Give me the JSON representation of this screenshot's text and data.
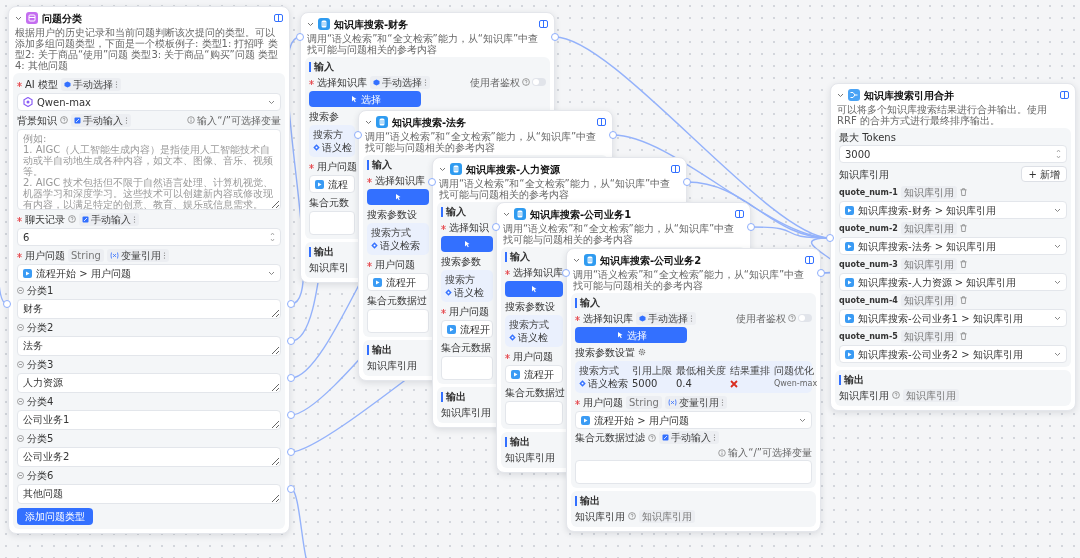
{
  "classify": {
    "title": "问题分类",
    "description": "根据用户的历史记录和当前问题判断该次提问的类型。可以添加多组问题类型，下面是一个模板例子: 类型1: 打招呼 类型2: 关于商品“使用”问题 类型3: 关于商品“购买”问题 类型4: 其他问题",
    "model": {
      "label": "AI 模型",
      "required": true,
      "mode": "手动选择",
      "value": "Qwen-max"
    },
    "background": {
      "label": "背景知识",
      "mode": "手动输入",
      "hint": "输入“/”可选择变量",
      "placeholder": "例如:\n1. AIGC（人工智能生成内容）是指使用人工智能技术自动或半自动地生成各种内容，如文本、图像、音乐、视频等。\n2. AIGC 技术包括但不限于自然语言处理、计算机视觉、机器学习和深度学习。这些技术可以创建新内容或修改现有内容，以满足特定的创意、教育、娱乐或信息需求。"
    },
    "history": {
      "label": "聊天记录",
      "required": true,
      "mode": "手动输入",
      "value": "6"
    },
    "question": {
      "label": "用户问题",
      "required": true,
      "type": "String",
      "mode": "变量引用",
      "value": "流程开始 > 用户问题"
    },
    "categories": [
      {
        "label": "分类1",
        "value": "财务"
      },
      {
        "label": "分类2",
        "value": "法务"
      },
      {
        "label": "分类3",
        "value": "人力资源"
      },
      {
        "label": "分类4",
        "value": "公司业务1"
      },
      {
        "label": "分类5",
        "value": "公司业务2"
      },
      {
        "label": "分类6",
        "value": "其他问题"
      }
    ],
    "add_button": "添加问题类型"
  },
  "kb_cards": [
    {
      "title": "知识库搜索-财务",
      "description": "调用“语义检索”和“全文检索”能力，从“知识库”中查找可能与问题相关的参考内容",
      "input": {
        "heading": "输入",
        "kb_required": true,
        "kb_label": "选择知识库",
        "kb_mode": "手动选择",
        "auth_label": "使用者鉴权",
        "auth_on": false,
        "select_button": "选择",
        "params_heading": "搜索参",
        "params": [
          {
            "label": "搜索方",
            "kind": "method",
            "value": "语义检"
          }
        ],
        "question_required": true,
        "question_label": "用户问题",
        "question_value": "流程",
        "filter_label": "集合元数"
      },
      "output": {
        "heading": "输出",
        "ref_label": "知识库引"
      }
    },
    {
      "title": "知识库搜索-法务",
      "description": "调用“语义检索”和“全文检索”能力，从“知识库”中查找可能与问题相关的参考内容",
      "input": {
        "heading": "输入",
        "kb_required": true,
        "kb_label": "选择知识库",
        "params_heading": "搜索参数设",
        "params": [
          {
            "label": "搜索方式",
            "kind": "method",
            "value": "语义检索"
          }
        ],
        "question_required": true,
        "question_label": "用户问题",
        "question_value": "流程开",
        "filter_label": "集合元数据过"
      },
      "output": {
        "heading": "输出",
        "ref_label": "知识库引用"
      }
    },
    {
      "title": "知识库搜索-人力资源",
      "description": "调用“语义检索”和“全文检索”能力，从“知识库”中查找可能与问题相关的参考内容",
      "input": {
        "heading": "输入",
        "kb_required": true,
        "kb_label": "选择知识",
        "params_heading": "搜索参数",
        "params": [
          {
            "label": "搜索方",
            "kind": "method",
            "value": "语义检"
          }
        ],
        "question_required": true,
        "question_label": "用户问题",
        "question_value": "流程开",
        "filter_label": "集合元数据"
      },
      "output": {
        "heading": "输出",
        "ref_label": "知识库引用"
      }
    },
    {
      "title": "知识库搜索-公司业务1",
      "description": "调用“语义检索”和“全文检索”能力，从“知识库”中查找可能与问题相关的参考内容",
      "input": {
        "heading": "输入",
        "kb_required": true,
        "kb_label": "选择知识库",
        "params_heading": "搜索参数设",
        "params": [
          {
            "label": "搜索方式",
            "kind": "method",
            "value": "语义检"
          }
        ],
        "question_required": true,
        "question_label": "用户问题",
        "question_value": "流程开",
        "filter_label": "集合元数据过"
      },
      "output": {
        "heading": "输出",
        "ref_label": "知识库引用"
      }
    },
    {
      "title": "知识库搜索-公司业务2",
      "description": "调用“语义检索”和“全文检索”能力，从“知识库”中查找可能与问题相关的参考内容",
      "input": {
        "heading": "输入",
        "kb_required": true,
        "kb_label": "选择知识库",
        "kb_mode": "手动选择",
        "auth_label": "使用者鉴权",
        "auth_on": false,
        "select_button": "选择",
        "params_heading": "搜索参数设置",
        "params": [
          {
            "label": "搜索方式",
            "kind": "method",
            "value": "语义检索"
          },
          {
            "label": "引用上限",
            "kind": "text",
            "value": "5000"
          },
          {
            "label": "最低相关度",
            "kind": "text",
            "value": "0.4"
          },
          {
            "label": "结果重排",
            "kind": "flag",
            "on": false
          },
          {
            "label": "问题优化",
            "kind": "text",
            "value": "Qwen-max"
          }
        ],
        "question_required": true,
        "question_label": "用户问题",
        "question_type": "String",
        "question_mode": "变量引用",
        "question_value": "流程开始 > 用户问题",
        "filter_label": "集合元数据过滤",
        "filter_mode": "手动输入",
        "filter_hint": "输入“/”可选择变量"
      },
      "output": {
        "heading": "输出",
        "ref_label": "知识库引用",
        "ref_type": "知识库引用"
      }
    }
  ],
  "merge": {
    "title": "知识库搜索引用合并",
    "description": "可以将多个知识库搜索结果进行合并输出。使用 RRF 的合并方式进行最终排序输出。",
    "tokens_label": "最大 Tokens",
    "tokens_value": "3000",
    "refs_heading": "知识库引用",
    "add_button": "+ 新增",
    "quotes": [
      {
        "name": "quote_num-1",
        "type": "知识库引用",
        "value": "知识库搜索-财务 > 知识库引用"
      },
      {
        "name": "quote_num-2",
        "type": "知识库引用",
        "value": "知识库搜索-法务 > 知识库引用"
      },
      {
        "name": "quote_num-3",
        "type": "知识库引用",
        "value": "知识库搜索-人力资源 > 知识库引用"
      },
      {
        "name": "quote_num-4",
        "type": "知识库引用",
        "value": "知识库搜索-公司业务1 > 知识库引用"
      },
      {
        "name": "quote_num-5",
        "type": "知识库引用",
        "value": "知识库搜索-公司业务2 > 知识库引用"
      }
    ],
    "output": {
      "heading": "输出",
      "ref_label": "知识库引用",
      "ref_type": "知识库引用"
    }
  }
}
